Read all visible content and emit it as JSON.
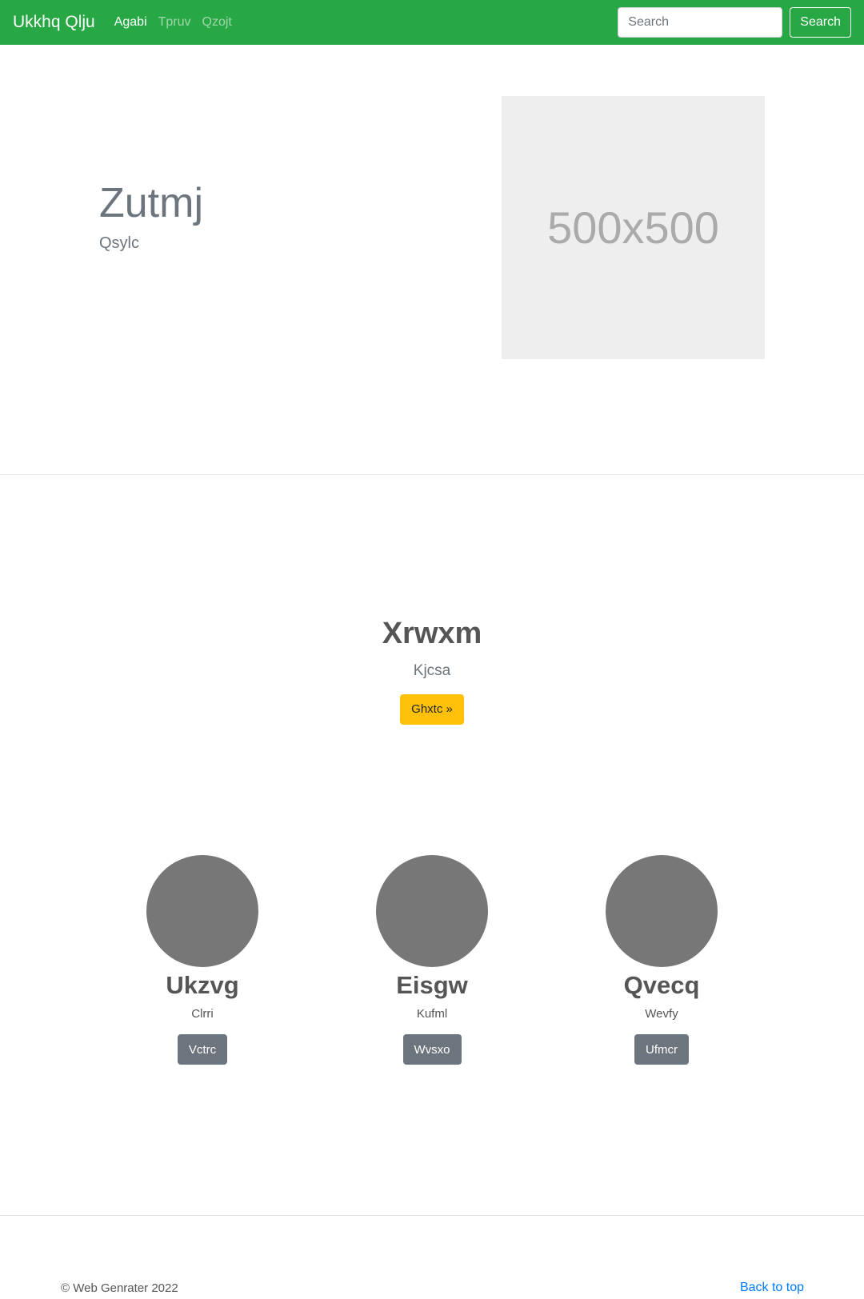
{
  "navbar": {
    "brand": "Ukkhq Qlju",
    "links": [
      {
        "label": "Agabi",
        "active": true
      },
      {
        "label": "Tpruv",
        "active": false
      },
      {
        "label": "Qzojt",
        "active": false
      }
    ],
    "search_placeholder": "Search",
    "search_button": "Search",
    "background_color": "#28a745"
  },
  "hero": {
    "title": "Zutmj",
    "subtitle": "Qsylc",
    "image_text": "500x500"
  },
  "feature": {
    "title": "Xrwxm",
    "subtitle": "Kjcsa",
    "button": "Ghxtc »",
    "button_color": "#ffc107"
  },
  "cards": [
    {
      "title": "Ukzvg",
      "text": "Clrri",
      "button": "Vctrc"
    },
    {
      "title": "Eisgw",
      "text": "Kufml",
      "button": "Wvsxo"
    },
    {
      "title": "Qvecq",
      "text": "Wevfy",
      "button": "Ufmcr"
    }
  ],
  "footer": {
    "copyright": "© Web Genrater 2022",
    "back_to_top": "Back to top",
    "link_color": "#007bff"
  }
}
